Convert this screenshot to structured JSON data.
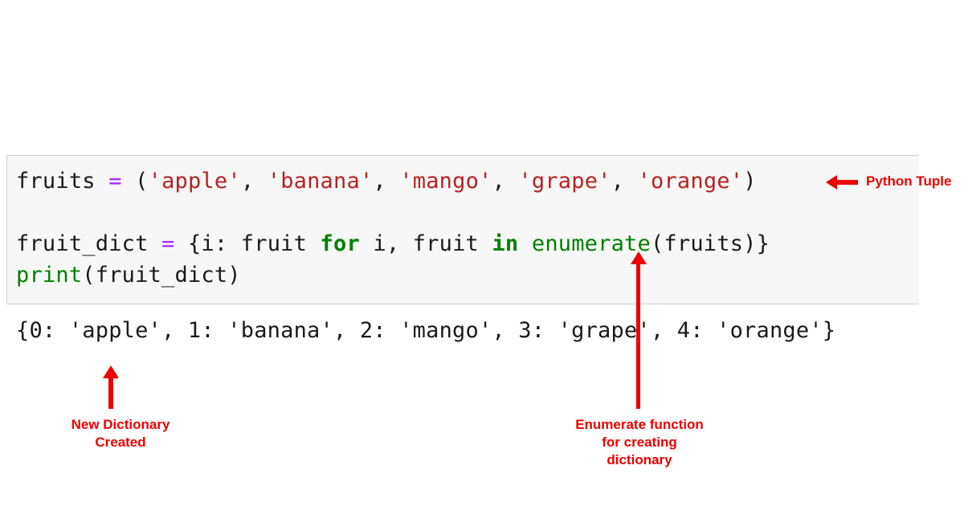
{
  "code_cell": {
    "line1": {
      "var": "fruits",
      "op": "=",
      "open": "(",
      "items": [
        "'apple'",
        "'banana'",
        "'mango'",
        "'grape'",
        "'orange'"
      ],
      "close": ")"
    },
    "line2": {
      "var": "fruit_dict",
      "op": "=",
      "expr_start": "{i: fruit ",
      "kw_for": "for",
      "mid": " i, fruit ",
      "kw_in": "in",
      "func": "enumerate",
      "args": "(fruits)}"
    },
    "line3": {
      "func": "print",
      "args": "(fruit_dict)"
    }
  },
  "output": "{0: 'apple', 1: 'banana', 2: 'mango', 3: 'grape', 4: 'orange'}",
  "annotations": {
    "tuple_label": "Python Tuple",
    "dict_label_line1": "New Dictionary",
    "dict_label_line2": "Created",
    "enum_label_line1": "Enumerate function",
    "enum_label_line2": "for creating",
    "enum_label_line3": "dictionary"
  },
  "colors": {
    "annotation": "#ee0000",
    "string": "#ba2121",
    "operator": "#aa22ff",
    "keyword": "#008000",
    "cell_background": "#f7f7f7"
  }
}
